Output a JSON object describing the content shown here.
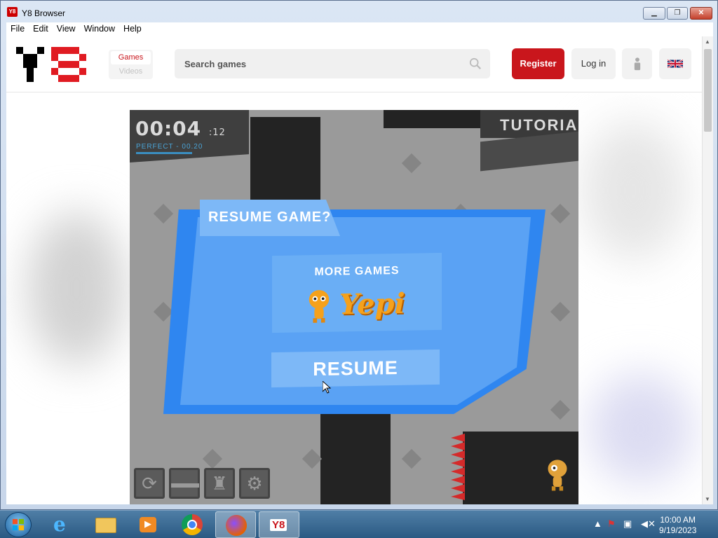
{
  "window": {
    "title": "Y8 Browser",
    "app_icon": "Y8",
    "min": "▁",
    "max": "❐",
    "close": "✕"
  },
  "menu": [
    "File",
    "Edit",
    "View",
    "Window",
    "Help"
  ],
  "site": {
    "nav_games": "Games",
    "nav_videos": "Videos",
    "search_placeholder": "Search games",
    "register": "Register",
    "login": "Log in",
    "brand_color": "#c9161c"
  },
  "game": {
    "timer": "00:04",
    "timer_ms": ":12",
    "perfect": "PERFECT - 00.20",
    "tutorial": "TUTORIAL",
    "dialog_title": "RESUME GAME?",
    "more_games": "MORE GAMES",
    "yepi": "Yepi",
    "resume": "RESUME",
    "controls": [
      "restart-icon",
      "level-menu-icon",
      "trophy-icon",
      "settings-icon"
    ]
  },
  "taskbar": {
    "time": "10:00 AM",
    "date": "9/19/2023",
    "apps": [
      "internet-explorer-icon",
      "file-explorer-icon",
      "media-player-icon",
      "chrome-icon",
      "firefox-icon",
      "y8-browser-icon"
    ],
    "y8_label": "Y8"
  }
}
